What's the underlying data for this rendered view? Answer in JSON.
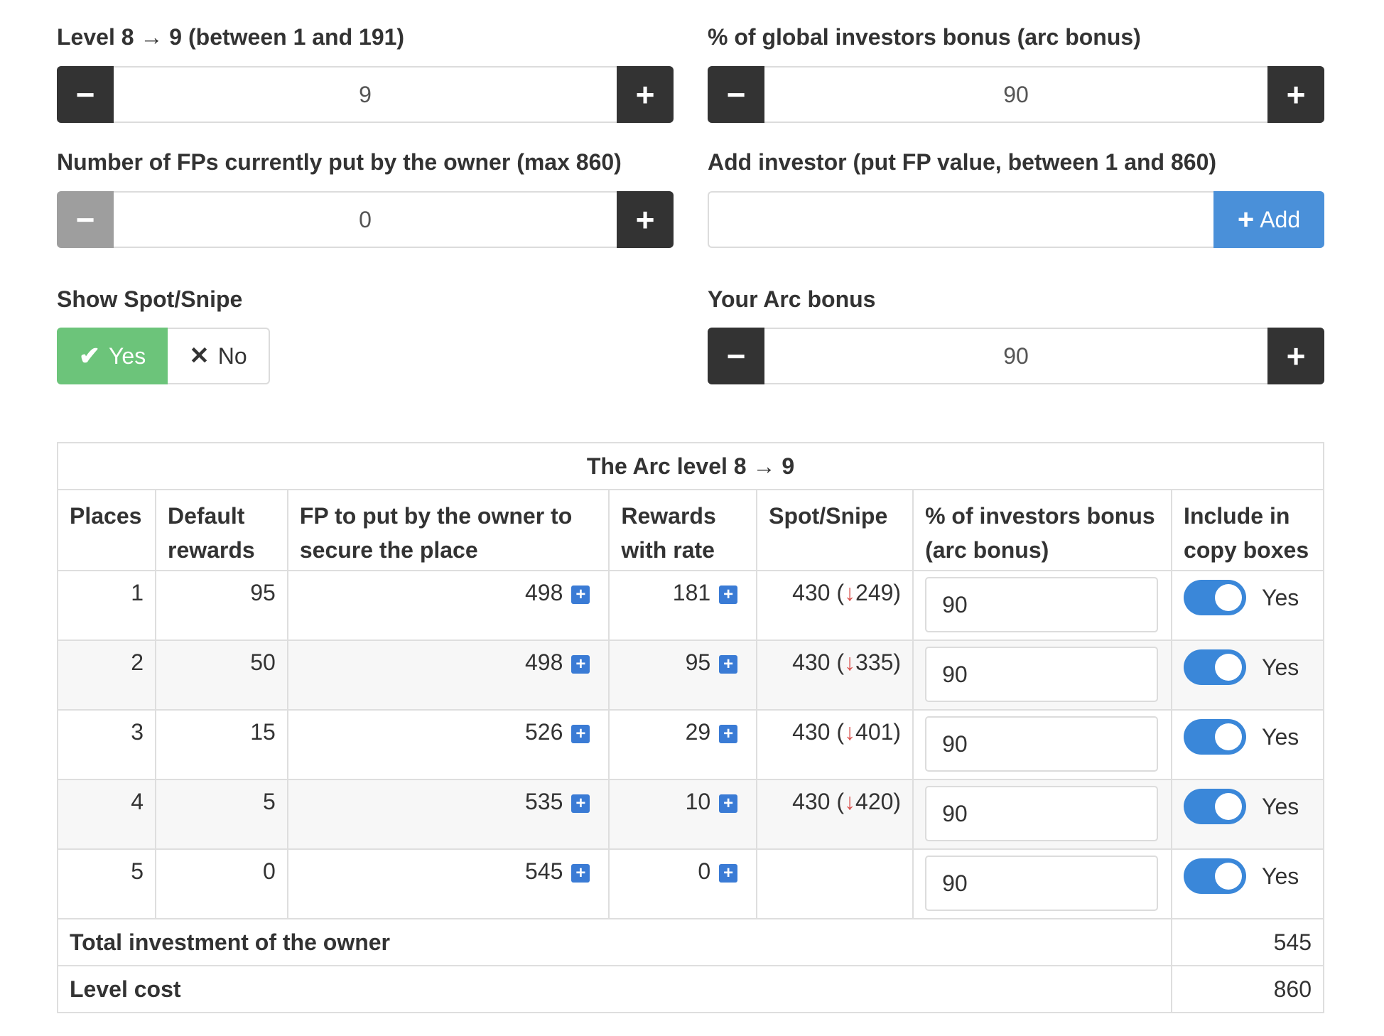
{
  "level_stepper": {
    "label": "Level 8 → 9 (between 1 and 191)",
    "value": "9",
    "minus": "−",
    "plus": "+"
  },
  "global_bonus_stepper": {
    "label": "% of global investors bonus (arc bonus)",
    "value": "90",
    "minus": "−",
    "plus": "+"
  },
  "owner_fps_stepper": {
    "label": "Number of FPs currently put by the owner (max 860)",
    "value": "0",
    "minus": "−",
    "plus": "+"
  },
  "add_investor": {
    "label": "Add investor (put FP value, between 1 and 860)",
    "value": "",
    "button_label": "Add"
  },
  "show_spot": {
    "label": "Show Spot/Snipe",
    "yes_label": "Yes",
    "no_label": "No",
    "selected": "Yes"
  },
  "your_arc_bonus": {
    "label": "Your Arc bonus",
    "value": "90",
    "minus": "−",
    "plus": "+"
  },
  "table": {
    "caption": "The Arc level 8 → 9",
    "headers": [
      "Places",
      "Default rewards",
      "FP to put by the owner to secure the place",
      "Rewards with rate",
      "Spot/Snipe",
      "% of investors bonus (arc bonus)",
      "Include in copy boxes"
    ],
    "rows": [
      {
        "place": "1",
        "default": "95",
        "fp": "498",
        "rewards": "181",
        "spot": "430 (",
        "snipe": "249)",
        "pct": "90",
        "include": "Yes"
      },
      {
        "place": "2",
        "default": "50",
        "fp": "498",
        "rewards": "95",
        "spot": "430 (",
        "snipe": "335)",
        "pct": "90",
        "include": "Yes"
      },
      {
        "place": "3",
        "default": "15",
        "fp": "526",
        "rewards": "29",
        "spot": "430 (",
        "snipe": "401)",
        "pct": "90",
        "include": "Yes"
      },
      {
        "place": "4",
        "default": "5",
        "fp": "535",
        "rewards": "10",
        "spot": "430 (",
        "snipe": "420)",
        "pct": "90",
        "include": "Yes"
      },
      {
        "place": "5",
        "default": "0",
        "fp": "545",
        "rewards": "0",
        "spot": "",
        "snipe": "",
        "pct": "90",
        "include": "Yes"
      }
    ],
    "total_label": "Total investment of the owner",
    "total_value": "545",
    "cost_label": "Level cost",
    "cost_value": "860"
  },
  "colors": {
    "dark_button": "#333333",
    "add_button": "#4a90d9",
    "yes_toggle": "#6cc47a",
    "switch_on": "#3a87d9",
    "snipe_arrow": "#d9534f"
  }
}
